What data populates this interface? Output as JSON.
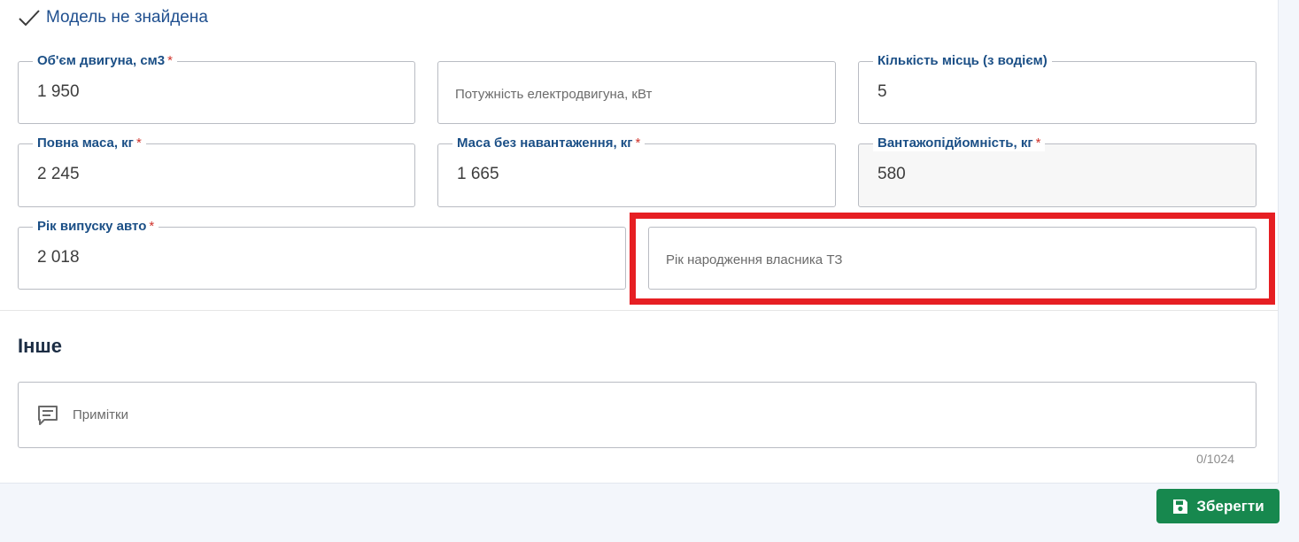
{
  "model_status": {
    "icon": "check-icon",
    "text": "Модель не знайдена"
  },
  "fields": {
    "engine_volume": {
      "label": "Об'єм двигуна, см3",
      "required": "*",
      "value": "1 950"
    },
    "electric_power": {
      "placeholder": "Потужність електродвигуна, кВт"
    },
    "seats": {
      "label": "Кількість місць (з водієм)",
      "value": "5"
    },
    "gross_mass": {
      "label": "Повна маса, кг",
      "required": "*",
      "value": "2 245"
    },
    "curb_mass": {
      "label": "Маса без навантаження, кг",
      "required": "*",
      "value": "1 665"
    },
    "load_capacity": {
      "label": "Вантажопідйомність, кг",
      "required": "*",
      "value": "580"
    },
    "year": {
      "label": "Рік випуску авто",
      "required": "*",
      "value": "2 018"
    },
    "owner_birth_year": {
      "placeholder": "Рік народження власника ТЗ"
    }
  },
  "other_section": {
    "title": "Інше",
    "notes_placeholder": "Примітки",
    "notes_icon": "comment-icon",
    "counter": "0/1024"
  },
  "save_button": {
    "label": "Зберегти",
    "icon": "floppy-disk-icon",
    "color": "#17884e"
  },
  "colors": {
    "label": "#1b4f86",
    "required": "#d0342c",
    "highlight": "#e61f23"
  }
}
